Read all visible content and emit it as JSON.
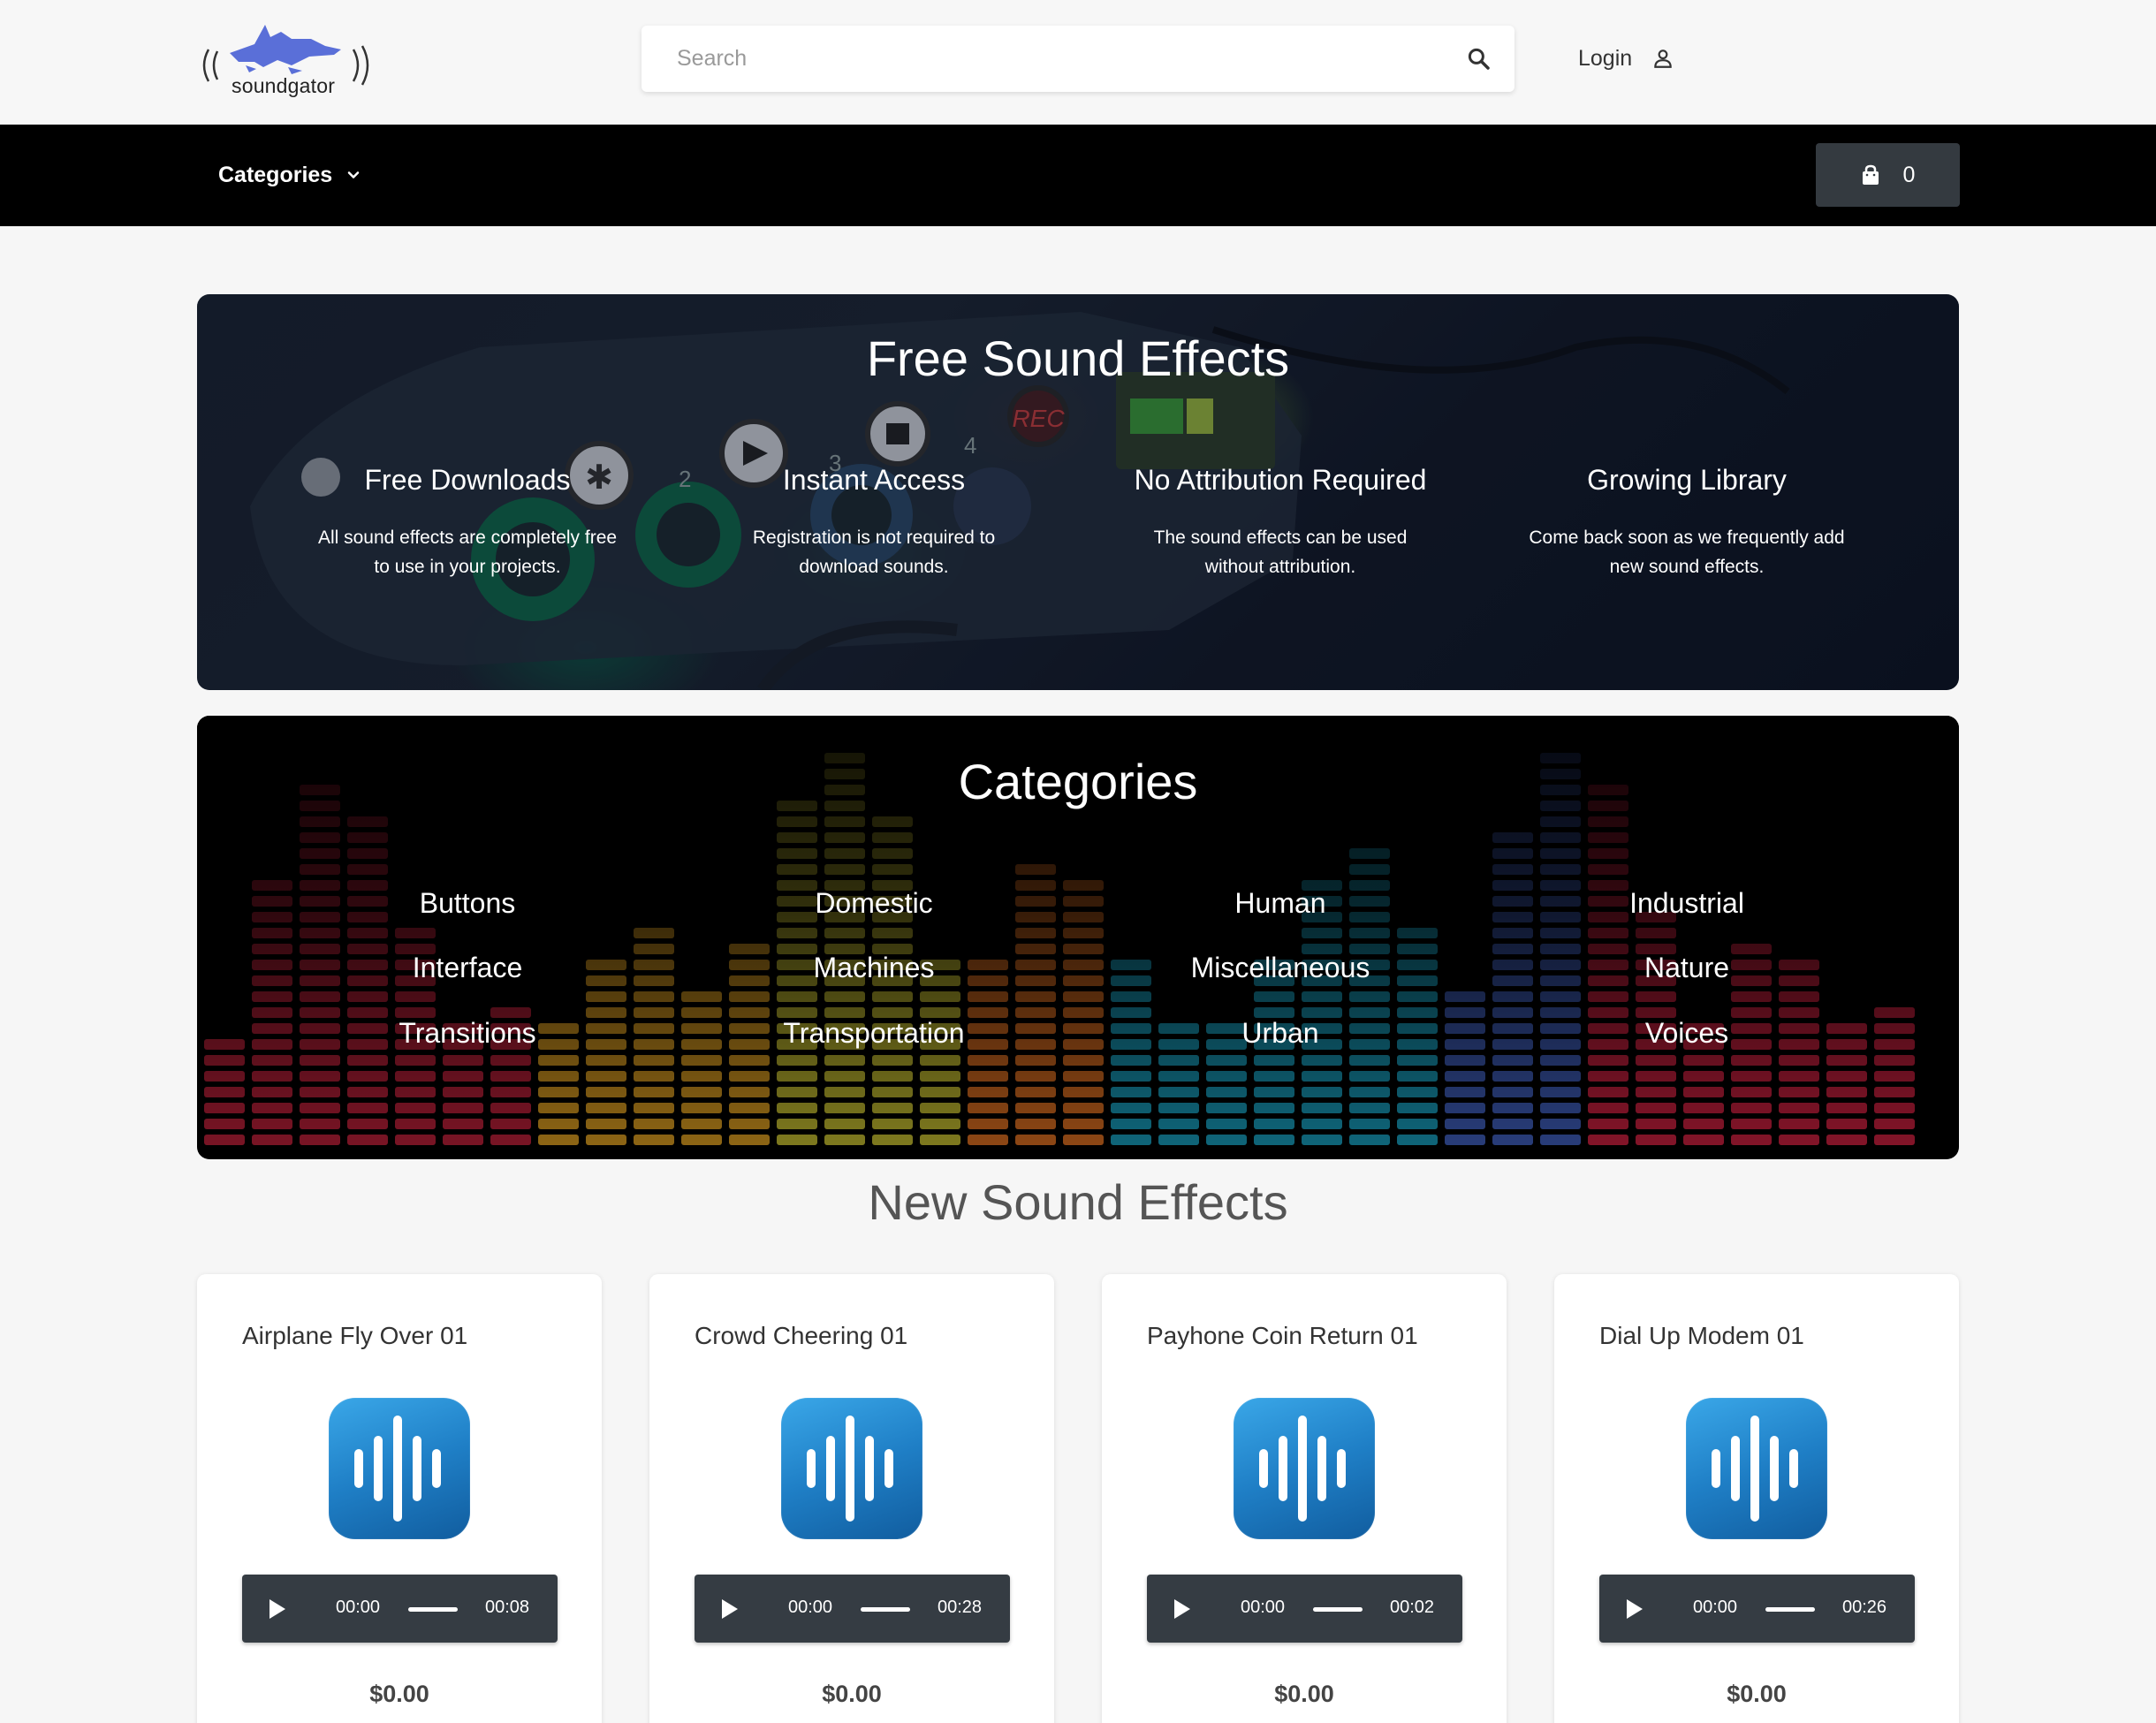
{
  "header": {
    "logo_text": "soundgator",
    "search_placeholder": "Search",
    "login_label": "Login"
  },
  "navbar": {
    "categories_label": "Categories",
    "cart_count": "0"
  },
  "hero": {
    "title": "Free Sound Effects",
    "features": [
      {
        "title": "Free Downloads",
        "desc_line1": "All sound effects are completely free",
        "desc_line2": "to use in your projects."
      },
      {
        "title": "Instant Access",
        "desc_line1": "Registration is not required to",
        "desc_line2": "download sounds."
      },
      {
        "title": "No Attribution Required",
        "desc_line1": "The sound effects can be used",
        "desc_line2": "without attribution."
      },
      {
        "title": "Growing Library",
        "desc_line1": "Come back soon as we frequently add",
        "desc_line2": "new sound effects."
      }
    ],
    "photo_labels": {
      "rec": "REC",
      "dial_2": "2",
      "dial_3": "3",
      "dial_4": "4"
    }
  },
  "categories": {
    "title": "Categories",
    "items": [
      "Buttons",
      "Domestic",
      "Human",
      "Industrial",
      "Interface",
      "Machines",
      "Miscellaneous",
      "Nature",
      "Transitions",
      "Transportation",
      "Urban",
      "Voices"
    ]
  },
  "new_effects": {
    "title": "New Sound Effects",
    "cards": [
      {
        "title": "Airplane Fly Over 01",
        "current_time": "00:00",
        "duration": "00:08",
        "price": "$0.00"
      },
      {
        "title": "Crowd Cheering 01",
        "current_time": "00:00",
        "duration": "00:28",
        "price": "$0.00"
      },
      {
        "title": "Payhone Coin Return 01",
        "current_time": "00:00",
        "duration": "00:02",
        "price": "$0.00"
      },
      {
        "title": "Dial Up Modem 01",
        "current_time": "00:00",
        "duration": "00:26",
        "price": "$0.00"
      }
    ]
  },
  "icons": {
    "search": "search-icon",
    "login": "user-icon",
    "categories_dropdown": "chevron-down-icon",
    "cart": "shopping-bag-icon",
    "card_image": "sound-wave-icon",
    "play": "play-icon"
  },
  "colors": {
    "navbar_bg": "#000000",
    "cart_button_bg": "#343a40",
    "player_bg": "#353c43",
    "logo_accent": "#5a6fd8",
    "app_icon_blue": "#1f7fc6"
  }
}
